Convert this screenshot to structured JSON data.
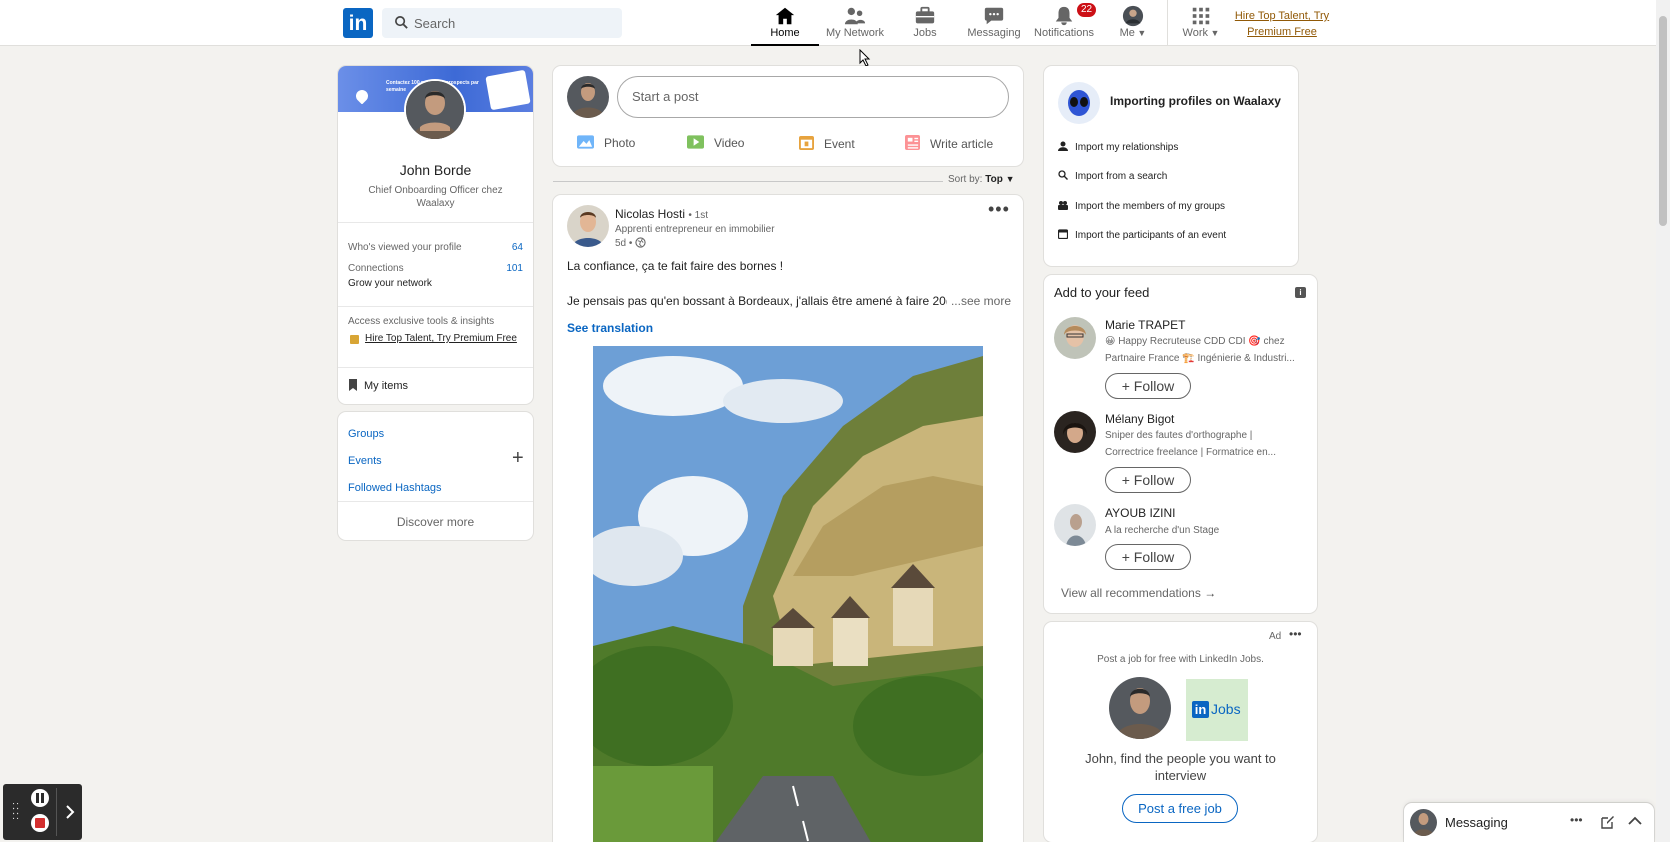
{
  "header": {
    "logo": "in",
    "search_placeholder": "Search",
    "nav": {
      "home": "Home",
      "network": "My Network",
      "jobs": "Jobs",
      "messaging": "Messaging",
      "notifications": "Notifications",
      "notifications_count": "22",
      "me": "Me",
      "work": "Work"
    },
    "premium_link": "Hire Top Talent, Try Premium Free"
  },
  "profile": {
    "name": "John Borde",
    "headline": "Chief Onboarding Officer chez Waalaxy",
    "views_label": "Who's viewed your profile",
    "views_count": "64",
    "connections_label": "Connections",
    "connections_count": "101",
    "grow_label": "Grow your network",
    "premium_text": "Access exclusive tools & insights",
    "premium_link": "Hire Top Talent, Try Premium Free",
    "my_items": "My items",
    "banner_text": "Contactez 100 nouveaux prospects par semaine"
  },
  "community": {
    "groups": "Groups",
    "events": "Events",
    "hashtags": "Followed Hashtags",
    "discover": "Discover more"
  },
  "share": {
    "placeholder": "Start a post",
    "photo": "Photo",
    "video": "Video",
    "event": "Event",
    "article": "Write article"
  },
  "sort": {
    "label": "Sort by:",
    "value": "Top"
  },
  "post": {
    "author": "Nicolas Hosti",
    "degree": "• 1st",
    "headline": "Apprenti entrepreneur en immobilier",
    "time": "5d •",
    "line1": "La confiance, ça te fait faire des bornes !",
    "line2": "Je pensais pas qu'en bossant à Bordeaux, j'allais être amené à faire 20(",
    "see_more": "...see more",
    "translation": "See translation"
  },
  "waalaxy": {
    "title": "Importing profiles on Waalaxy",
    "items": [
      "Import my relationships",
      "Import from a search",
      "Import the members of my groups",
      "Import the participants of an event"
    ]
  },
  "feed": {
    "title": "Add to your feed",
    "follow": "Follow",
    "people": [
      {
        "name": "Marie TRAPET",
        "line1": "😀 Happy Recruteuse CDD CDI 🎯 chez",
        "line2": "Partnaire France 🏗️ Ingénierie & Industri..."
      },
      {
        "name": "Mélany Bigot",
        "line1": "Sniper des fautes d'orthographe |",
        "line2": "Correctrice freelance | Formatrice en..."
      },
      {
        "name": "AYOUB IZINI",
        "line1": "A la recherche d'un Stage",
        "line2": ""
      }
    ],
    "view_all": "View all recommendations"
  },
  "ad": {
    "label": "Ad",
    "top_text": "Post a job for free with LinkedIn Jobs.",
    "jobs_logo_in": "in",
    "jobs_logo_text": "Jobs",
    "message": "John, find the people you want to interview",
    "button": "Post a free job"
  },
  "messaging": {
    "label": "Messaging"
  },
  "colors": {
    "brand": "#0a66c2",
    "premium": "#915907",
    "badge": "#cc1016",
    "recorder": "#2b2b2b"
  }
}
